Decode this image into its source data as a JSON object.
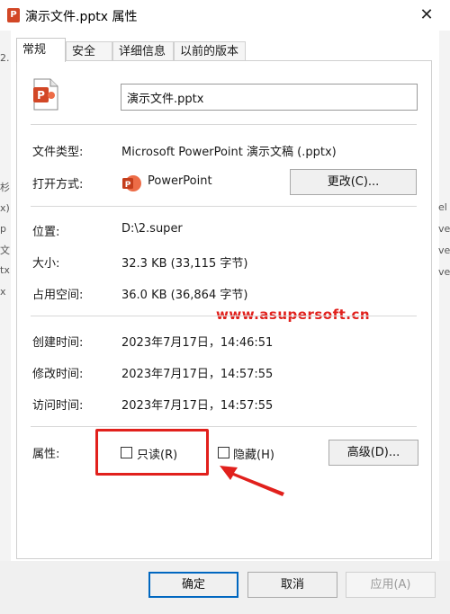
{
  "window": {
    "title": "演示文件.pptx 属性",
    "icon": "P"
  },
  "tabs": [
    {
      "label": "常规",
      "active": true
    },
    {
      "label": "安全",
      "active": false
    },
    {
      "label": "详细信息",
      "active": false
    },
    {
      "label": "以前的版本",
      "active": false
    }
  ],
  "general": {
    "filename": "演示文件.pptx",
    "file_type_label": "文件类型:",
    "file_type_value": "Microsoft PowerPoint 演示文稿 (.pptx)",
    "open_with_label": "打开方式:",
    "open_with_value": "PowerPoint",
    "change_button": "更改(C)...",
    "location_label": "位置:",
    "location_value": "D:\\2.super",
    "size_label": "大小:",
    "size_value": "32.3 KB (33,115 字节)",
    "disk_size_label": "占用空间:",
    "disk_size_value": "36.0 KB (36,864 字节)",
    "created_label": "创建时间:",
    "created_value": "2023年7月17日，14:46:51",
    "modified_label": "修改时间:",
    "modified_value": "2023年7月17日，14:57:55",
    "accessed_label": "访问时间:",
    "accessed_value": "2023年7月17日，14:57:55",
    "attributes_label": "属性:",
    "readonly_label": "只读(R)",
    "readonly_checked": false,
    "hidden_label": "隐藏(H)",
    "hidden_checked": false,
    "advanced_button": "高级(D)..."
  },
  "watermark": "www.asupersoft.cn",
  "footer": {
    "ok": "确定",
    "cancel": "取消",
    "apply": "应用(A)"
  },
  "background_fragments": [
    "2.",
    "杉",
    "x)",
    "p",
    "文",
    "tx",
    "x",
    "el",
    "ve",
    "ve",
    "ve"
  ],
  "colors": {
    "accent": "#0067c0",
    "highlight": "#e1201c",
    "ppt": "#d24726"
  }
}
